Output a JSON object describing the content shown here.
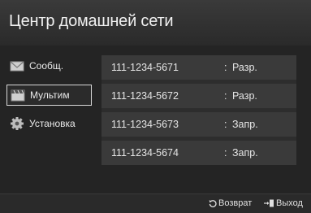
{
  "header": {
    "title": "Центр домашней сети"
  },
  "sidebar": {
    "items": [
      {
        "label": "Сообщ.",
        "icon": "envelope-icon",
        "selected": false
      },
      {
        "label": "Мультим",
        "icon": "film-icon",
        "selected": true
      },
      {
        "label": "Установка",
        "icon": "gear-icon",
        "selected": false
      }
    ]
  },
  "devices": [
    {
      "number": "111-1234-5671",
      "status": "Разр."
    },
    {
      "number": "111-1234-5672",
      "status": "Разр."
    },
    {
      "number": "111-1234-5673",
      "status": "Запр."
    },
    {
      "number": "111-1234-5674",
      "status": "Запр."
    }
  ],
  "footer": {
    "return_label": "Возврат",
    "exit_label": "Выход",
    "return_icon": "return-icon",
    "exit_icon": "exit-icon"
  },
  "colors": {
    "background": "#242424",
    "row": "#3a3a3a",
    "text": "#e6e6e6"
  }
}
